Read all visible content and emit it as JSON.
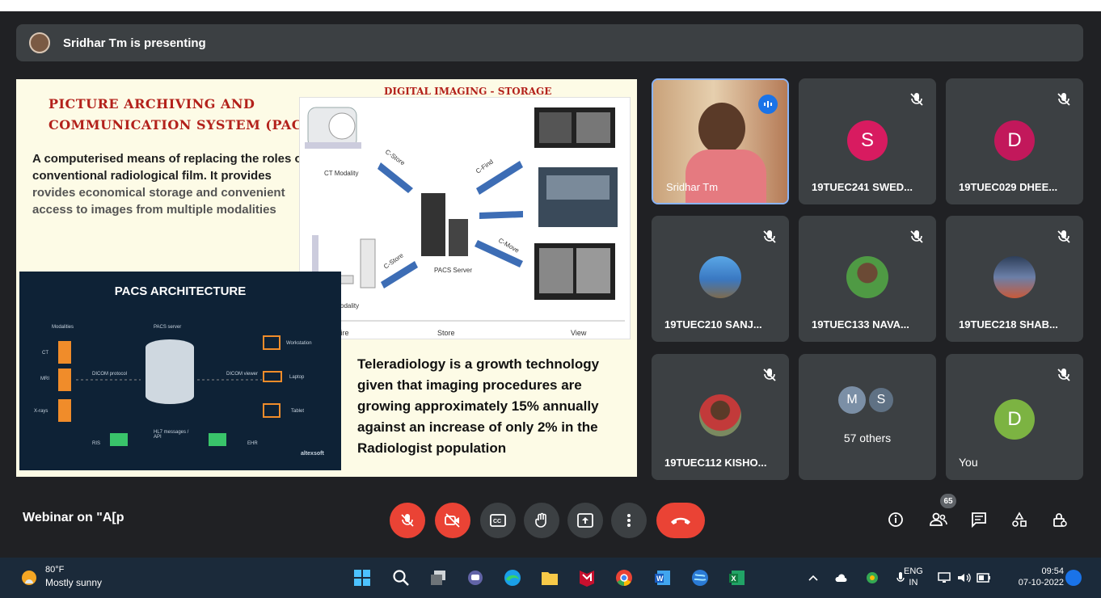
{
  "presenter": {
    "text": "Sridhar Tm is presenting"
  },
  "slide": {
    "title_line1": "PICTURE ARCHIVING AND",
    "title_line2": "COMMUNICATION SYSTEM (PACS)",
    "subtitle": "DIGITAL IMAGING - STORAGE",
    "body_part1": "A computerised means of replacing the roles of conventional radiological film. It provides",
    "body_part2": "rovides economical storage and convenient access to images from multiple modalities",
    "teleradiology": "Teleradiology is a growth technology given that imaging procedures are growing approximately 15% annually against an increase of only 2% in the Radiologist population",
    "diagram": {
      "ct": "CT Modality",
      "xray": "X-ray Modality",
      "server": "PACS Server",
      "cstore1": "C-Store",
      "cstore2": "C-Store",
      "cfind": "C-Find",
      "cmove": "C-Move",
      "acquire": "Acquire",
      "store": "Store",
      "view": "View"
    },
    "architecture": {
      "title": "PACS ARCHITECTURE",
      "modalities": "Modalities",
      "pacs_server": "PACS server",
      "ct": "CT",
      "mri": "MRI",
      "xrays": "X-rays",
      "dicom_protocol": "DICOM protocol",
      "dicom_viewer": "DICOM viewer",
      "workstation": "Workstation",
      "laptop": "Laptop",
      "tablet": "Tablet",
      "ris": "RIS",
      "hl7": "HL7 messages / API",
      "ehr": "EHR",
      "logo": "altexsoft"
    }
  },
  "participants": [
    {
      "name": "Sridhar Tm"
    },
    {
      "name": "19TUEC241 SWED...",
      "letter": "S",
      "color": "#d81b60"
    },
    {
      "name": "19TUEC029 DHEE...",
      "letter": "D",
      "color": "#c2185b"
    },
    {
      "name": "19TUEC210 SANJ..."
    },
    {
      "name": "19TUEC133 NAVA..."
    },
    {
      "name": "19TUEC218 SHAB..."
    },
    {
      "name": "19TUEC112 KISHO..."
    },
    {
      "name": "57 others",
      "letter1": "M",
      "letter2": "S"
    },
    {
      "name": "You",
      "letter": "D",
      "color": "#7cb342"
    }
  ],
  "controls": {
    "meeting_title": "Webinar on \"A[p",
    "people_count": "65"
  },
  "taskbar": {
    "temp": "80°F",
    "weather": "Mostly sunny",
    "lang1": "ENG",
    "lang2": "IN",
    "time": "09:54",
    "date": "07-10-2022"
  }
}
